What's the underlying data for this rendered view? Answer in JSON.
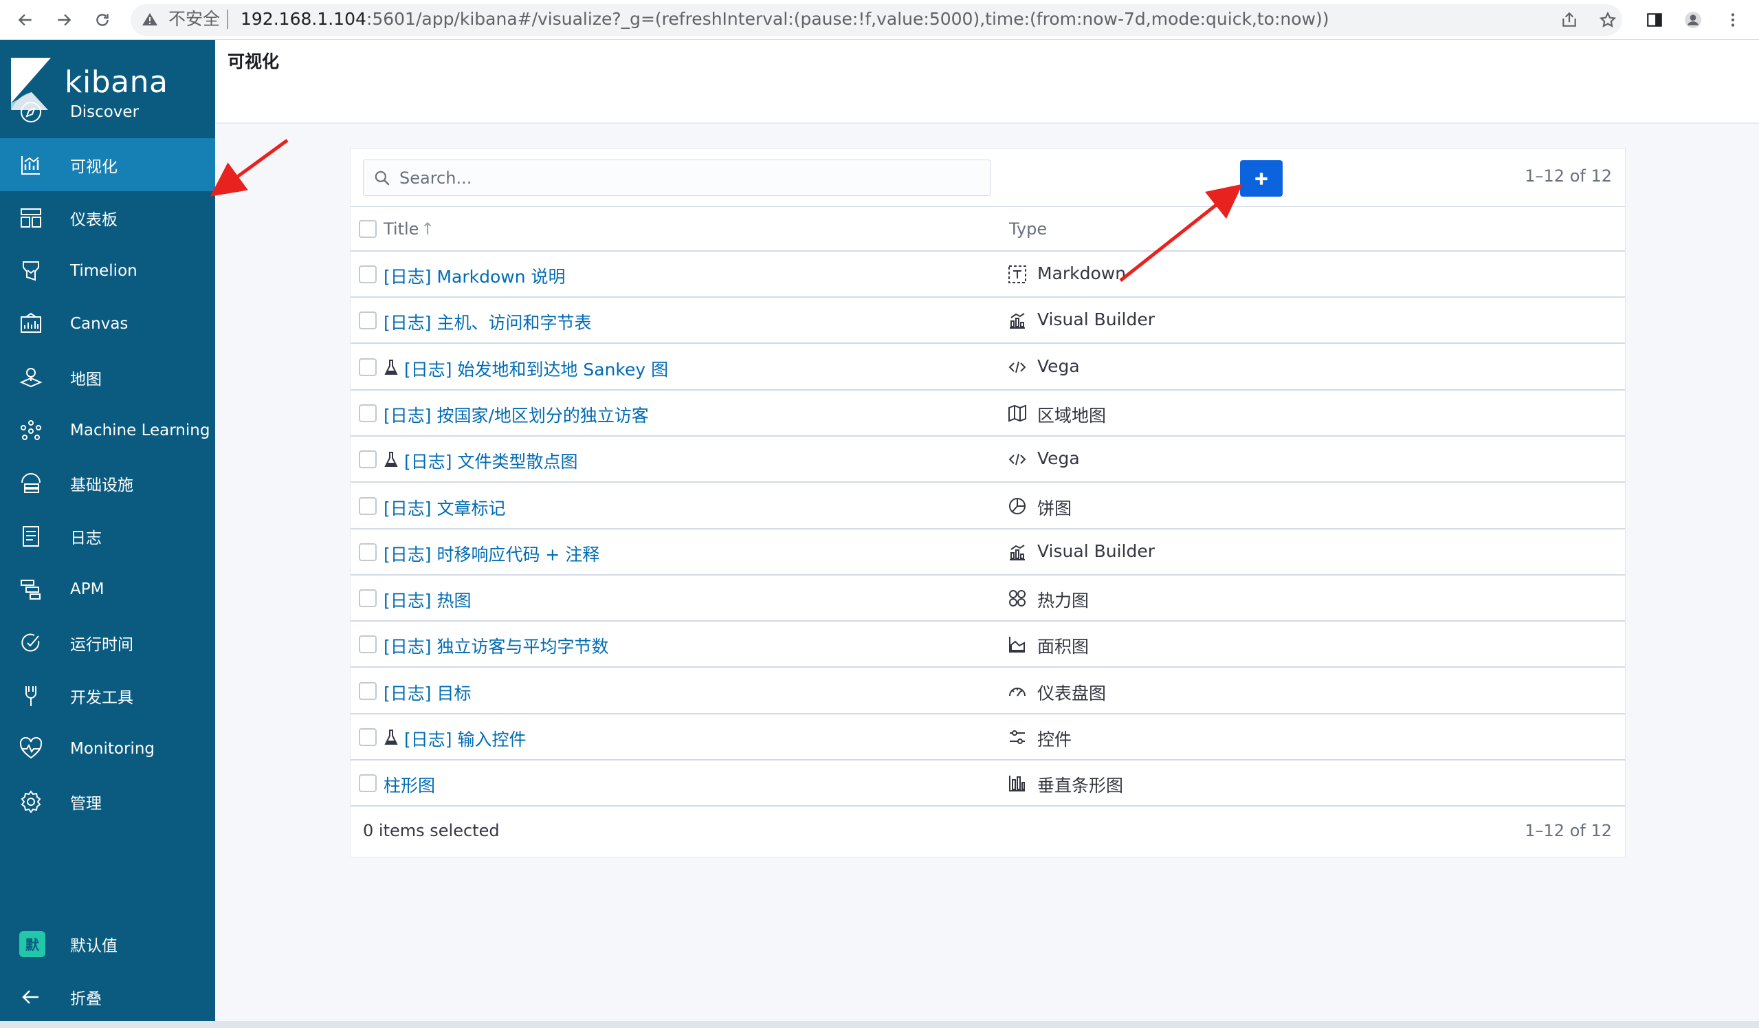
{
  "browser": {
    "security_label": "不安全",
    "url_host": "192.168.1.104",
    "url_rest": ":5601/app/kibana#/visualize?_g=(refreshInterval:(pause:!f,value:5000),time:(from:now-7d,mode:quick,to:now))"
  },
  "brand": {
    "name": "kibana"
  },
  "nav": [
    {
      "label": "Discover",
      "icon": "compass-icon"
    },
    {
      "label": "可视化",
      "icon": "visualize-icon",
      "active": true
    },
    {
      "label": "仪表板",
      "icon": "dashboard-icon"
    },
    {
      "label": "Timelion",
      "icon": "timelion-icon"
    },
    {
      "label": "Canvas",
      "icon": "canvas-icon"
    },
    {
      "label": "地图",
      "icon": "maps-icon"
    },
    {
      "label": "Machine Learning",
      "icon": "machine-learning-icon"
    },
    {
      "label": "基础设施",
      "icon": "infrastructure-icon"
    },
    {
      "label": "日志",
      "icon": "logs-icon"
    },
    {
      "label": "APM",
      "icon": "apm-icon"
    },
    {
      "label": "运行时间",
      "icon": "uptime-icon"
    },
    {
      "label": "开发工具",
      "icon": "dev-tools-icon"
    },
    {
      "label": "Monitoring",
      "icon": "monitoring-icon"
    },
    {
      "label": "管理",
      "icon": "gear-icon"
    }
  ],
  "space": {
    "badge": "默",
    "label": "默认值"
  },
  "collapse": {
    "label": "折叠"
  },
  "page": {
    "title": "可视化"
  },
  "search": {
    "placeholder": "Search..."
  },
  "pager": {
    "range": "1–12 of 12"
  },
  "table": {
    "columns": {
      "title": "Title",
      "type": "Type"
    },
    "rows": [
      {
        "title": "[日志] Markdown 说明",
        "type": "Markdown",
        "type_icon": "markdown-icon",
        "experimental": false
      },
      {
        "title": "[日志] 主机、访问和字节表",
        "type": "Visual Builder",
        "type_icon": "visual-builder-icon",
        "experimental": false
      },
      {
        "title": "[日志] 始发地和到达地 Sankey 图",
        "type": "Vega",
        "type_icon": "code-icon",
        "experimental": true
      },
      {
        "title": "[日志] 按国家/地区划分的独立访客",
        "type": "区域地图",
        "type_icon": "map-icon",
        "experimental": false
      },
      {
        "title": "[日志] 文件类型散点图",
        "type": "Vega",
        "type_icon": "code-icon",
        "experimental": true
      },
      {
        "title": "[日志] 文章标记",
        "type": "饼图",
        "type_icon": "pie-chart-icon",
        "experimental": false
      },
      {
        "title": "[日志] 时移响应代码 + 注释",
        "type": "Visual Builder",
        "type_icon": "visual-builder-icon",
        "experimental": false
      },
      {
        "title": "[日志] 热图",
        "type": "热力图",
        "type_icon": "heatmap-icon",
        "experimental": false
      },
      {
        "title": "[日志] 独立访客与平均字节数",
        "type": "面积图",
        "type_icon": "area-chart-icon",
        "experimental": false
      },
      {
        "title": "[日志] 目标",
        "type": "仪表盘图",
        "type_icon": "gauge-icon",
        "experimental": false
      },
      {
        "title": "[日志] 输入控件",
        "type": "控件",
        "type_icon": "controls-icon",
        "experimental": true
      },
      {
        "title": "柱形图",
        "type": "垂直条形图",
        "type_icon": "bar-chart-icon",
        "experimental": false
      }
    ]
  },
  "footer": {
    "selected": "0 items selected"
  },
  "colors": {
    "sidebar": "#0a5b7f",
    "active": "#167fb3",
    "primary": "#0b64dd",
    "link": "#006bb4",
    "annotation": "#e8231f"
  }
}
